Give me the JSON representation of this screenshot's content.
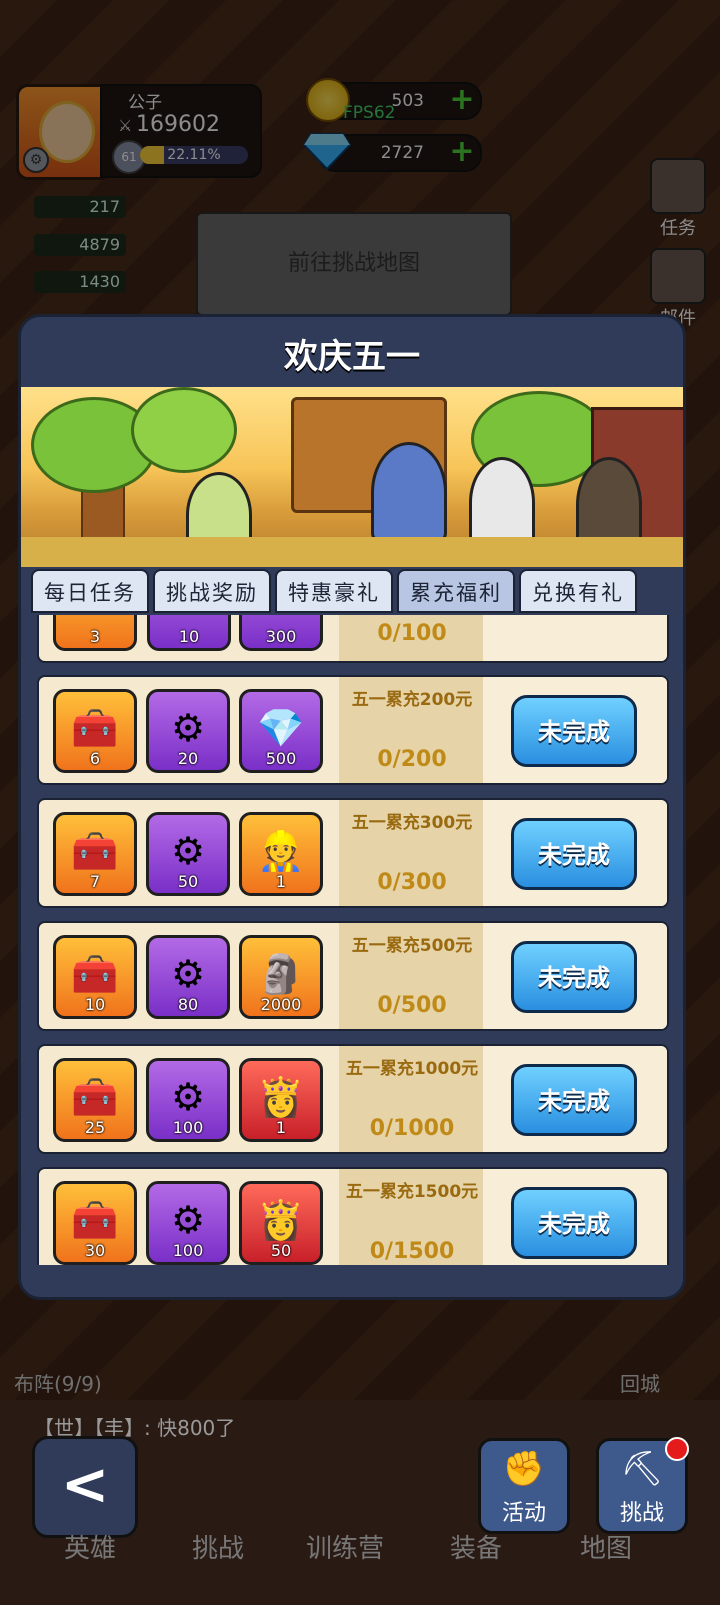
{
  "hud": {
    "player_name": "公子",
    "power": "169602",
    "level": "61",
    "exp_percent": "22.11%",
    "exp_fraction": 0.2211,
    "gold": "503",
    "gems": "2727",
    "fps": "FPS62",
    "stats": [
      "217",
      "4879",
      "1430"
    ],
    "side_tasks": "任务",
    "side_mail": "邮件",
    "go_map": "前往挑战地图"
  },
  "modal": {
    "title": "欢庆五一",
    "tabs": [
      "每日任务",
      "挑战奖励",
      "特惠豪礼",
      "累充福利",
      "兑换有礼"
    ],
    "active_tab": 3,
    "partial_row": {
      "counts": [
        "3",
        "10",
        "300"
      ],
      "progress": "0/100"
    },
    "rows": [
      {
        "title": "五一累充200元",
        "progress": "0/200",
        "button": "未完成",
        "items": [
          {
            "icon": "chest-icon",
            "count": "6"
          },
          {
            "icon": "gear-icon",
            "count": "20"
          },
          {
            "icon": "gem-icon",
            "count": "500"
          }
        ]
      },
      {
        "title": "五一累充300元",
        "progress": "0/300",
        "button": "未完成",
        "items": [
          {
            "icon": "chest-icon",
            "count": "7"
          },
          {
            "icon": "gear-icon",
            "count": "50"
          },
          {
            "icon": "worker-icon",
            "count": "1"
          }
        ]
      },
      {
        "title": "五一累充500元",
        "progress": "0/500",
        "button": "未完成",
        "items": [
          {
            "icon": "chest-icon",
            "count": "10"
          },
          {
            "icon": "gear-icon",
            "count": "80"
          },
          {
            "icon": "mask-icon",
            "count": "2000"
          }
        ]
      },
      {
        "title": "五一累充1000元",
        "progress": "0/1000",
        "button": "未完成",
        "items": [
          {
            "icon": "chest-icon",
            "count": "25"
          },
          {
            "icon": "gear-icon",
            "count": "100"
          },
          {
            "icon": "hero-card-icon",
            "count": "1"
          }
        ]
      },
      {
        "title": "五一累充1500元",
        "progress": "0/1500",
        "button": "未完成",
        "items": [
          {
            "icon": "chest-icon",
            "count": "30"
          },
          {
            "icon": "gear-icon",
            "count": "100"
          },
          {
            "icon": "hero-shard-icon",
            "count": "50"
          }
        ]
      }
    ]
  },
  "bottom": {
    "formation": "布阵(9/9)",
    "back_city": "回城",
    "chat": "【世】【丰】: 快800了",
    "nav": [
      "英雄",
      "挑战",
      "训练营",
      "装备",
      "地图"
    ],
    "activity": "活动",
    "challenge": "挑战"
  },
  "colors": {
    "button_blue": "#2a8fe0",
    "gold_text": "#c08a18",
    "modal_bg": "#2f3b58"
  }
}
